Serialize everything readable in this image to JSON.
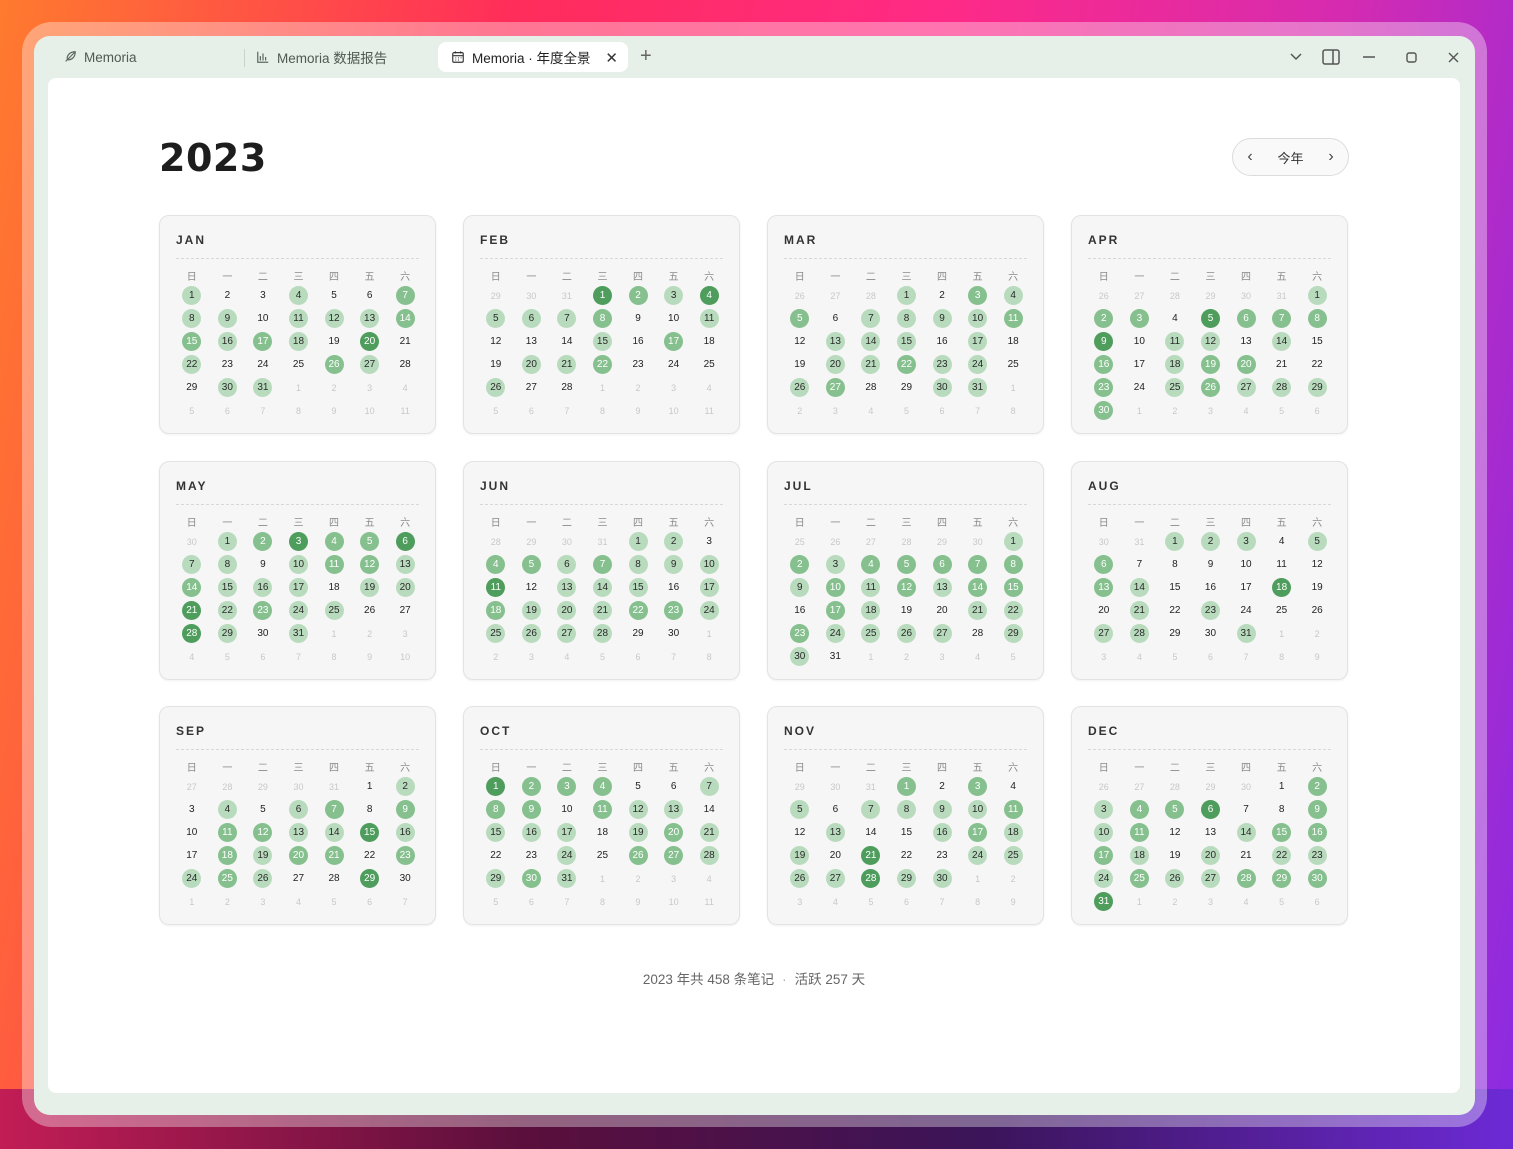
{
  "tabs": [
    {
      "label": "Memoria",
      "icon": "feather-icon"
    },
    {
      "label": "Memoria 数据报告",
      "icon": "bar-chart-icon"
    },
    {
      "label": "Memoria · 年度全景",
      "icon": "calendar-icon",
      "active": true
    }
  ],
  "tab_close": "✕",
  "tab_add": "+",
  "window_controls": {
    "dropdown": "⌄",
    "sidebar": "▯",
    "minimize": "—",
    "maximize": "▢",
    "close": "✕"
  },
  "year": "2023",
  "nav": {
    "prev": "‹",
    "today": "今年",
    "next": "›"
  },
  "weekdays": [
    "日",
    "一",
    "二",
    "三",
    "四",
    "五",
    "六"
  ],
  "colors": {
    "level1": "#b9dbbd",
    "level2": "#86c08e",
    "level3": "#4e9d5c"
  },
  "months": [
    {
      "name": "JAN",
      "lead": [],
      "days": 31,
      "tail": [
        1,
        2,
        3,
        4,
        5,
        6,
        7,
        8,
        9,
        10,
        11
      ],
      "l1": [
        1,
        4,
        8,
        9,
        11,
        12,
        13,
        16,
        18,
        22,
        27,
        30,
        31
      ],
      "l2": [
        7,
        14,
        15,
        17,
        26
      ],
      "l3": [
        20
      ]
    },
    {
      "name": "FEB",
      "lead": [
        29,
        30,
        31
      ],
      "days": 28,
      "tail": [
        1,
        2,
        3,
        4,
        5,
        6,
        7,
        8,
        9,
        10,
        11
      ],
      "l1": [
        3,
        5,
        6,
        7,
        11,
        15,
        20,
        21,
        26
      ],
      "l2": [
        2,
        8,
        17,
        22
      ],
      "l3": [
        1,
        4
      ]
    },
    {
      "name": "MAR",
      "lead": [
        26,
        27,
        28
      ],
      "days": 31,
      "tail": [
        1,
        2,
        3,
        4,
        5,
        6,
        7,
        8
      ],
      "l1": [
        1,
        4,
        7,
        8,
        9,
        10,
        13,
        14,
        15,
        17,
        20,
        21,
        23,
        24,
        26,
        30,
        31
      ],
      "l2": [
        3,
        5,
        11,
        22,
        27
      ],
      "l3": []
    },
    {
      "name": "APR",
      "lead": [
        26,
        27,
        28,
        29,
        30,
        31
      ],
      "days": 30,
      "tail": [
        1,
        2,
        3,
        4,
        5,
        6
      ],
      "l1": [
        1,
        11,
        12,
        14,
        18,
        25,
        27,
        28,
        29
      ],
      "l2": [
        2,
        3,
        6,
        7,
        8,
        16,
        19,
        20,
        23,
        26,
        30
      ],
      "l3": [
        5,
        9
      ]
    },
    {
      "name": "MAY",
      "lead": [
        30
      ],
      "days": 31,
      "tail": [
        1,
        2,
        3,
        4,
        5,
        6,
        7,
        8,
        9,
        10
      ],
      "l1": [
        1,
        7,
        8,
        10,
        13,
        15,
        16,
        17,
        19,
        20,
        22,
        24,
        25,
        29,
        31
      ],
      "l2": [
        2,
        4,
        5,
        11,
        12,
        14,
        23
      ],
      "l3": [
        3,
        6,
        21,
        28
      ]
    },
    {
      "name": "JUN",
      "lead": [
        28,
        29,
        30,
        31
      ],
      "days": 30,
      "tail": [
        1,
        2,
        3,
        4,
        5,
        6,
        7,
        8
      ],
      "l1": [
        1,
        2,
        6,
        8,
        9,
        10,
        13,
        14,
        15,
        17,
        19,
        20,
        21,
        24,
        25,
        26,
        27,
        28
      ],
      "l2": [
        4,
        5,
        7,
        18,
        22,
        23
      ],
      "l3": [
        11
      ]
    },
    {
      "name": "JUL",
      "lead": [
        25,
        26,
        27,
        28,
        29,
        30
      ],
      "days": 31,
      "tail": [
        1,
        2,
        3,
        4,
        5
      ],
      "l1": [
        1,
        3,
        9,
        11,
        13,
        18,
        21,
        22,
        24,
        25,
        26,
        27,
        29,
        30
      ],
      "l2": [
        2,
        4,
        5,
        6,
        7,
        8,
        10,
        12,
        14,
        15,
        17,
        23
      ],
      "l3": []
    },
    {
      "name": "AUG",
      "lead": [
        30,
        31
      ],
      "days": 31,
      "tail": [
        1,
        2,
        3,
        4,
        5,
        6,
        7,
        8,
        9
      ],
      "l1": [
        1,
        2,
        3,
        5,
        14,
        21,
        23,
        27,
        28,
        31
      ],
      "l2": [
        6,
        13
      ],
      "l3": [
        18
      ]
    },
    {
      "name": "SEP",
      "lead": [
        27,
        28,
        29,
        30,
        31
      ],
      "days": 30,
      "tail": [
        1,
        2,
        3,
        4,
        5,
        6,
        7
      ],
      "l1": [
        2,
        4,
        6,
        13,
        14,
        16,
        19,
        24,
        26
      ],
      "l2": [
        7,
        9,
        11,
        12,
        18,
        20,
        21,
        23,
        25
      ],
      "l3": [
        15,
        29
      ]
    },
    {
      "name": "OCT",
      "lead": [],
      "days": 31,
      "tail": [
        1,
        2,
        3,
        4,
        5,
        6,
        7,
        8,
        9,
        10,
        11
      ],
      "l1": [
        7,
        12,
        13,
        15,
        16,
        17,
        19,
        21,
        24,
        28,
        29,
        31
      ],
      "l2": [
        2,
        3,
        4,
        8,
        9,
        11,
        20,
        26,
        27,
        30
      ],
      "l3": [
        1
      ]
    },
    {
      "name": "NOV",
      "lead": [
        29,
        30,
        31
      ],
      "days": 30,
      "tail": [
        1,
        2,
        3,
        4,
        5,
        6,
        7,
        8,
        9
      ],
      "l1": [
        5,
        7,
        8,
        9,
        10,
        13,
        16,
        18,
        19,
        24,
        25,
        26,
        27,
        29,
        30
      ],
      "l2": [
        1,
        3,
        11,
        17
      ],
      "l3": [
        21,
        28
      ]
    },
    {
      "name": "DEC",
      "lead": [
        26,
        27,
        28,
        29,
        30
      ],
      "days": 31,
      "tail": [
        1,
        2,
        3,
        4,
        5,
        6
      ],
      "l1": [
        3,
        10,
        14,
        18,
        20,
        22,
        23,
        24,
        26,
        27
      ],
      "l2": [
        2,
        4,
        5,
        9,
        11,
        15,
        16,
        17,
        25,
        28,
        29,
        30
      ],
      "l3": [
        6,
        31
      ]
    }
  ],
  "footer": {
    "notes": "2023 年共 458 条笔记",
    "separator": "·",
    "active": "活跃 257 天"
  }
}
